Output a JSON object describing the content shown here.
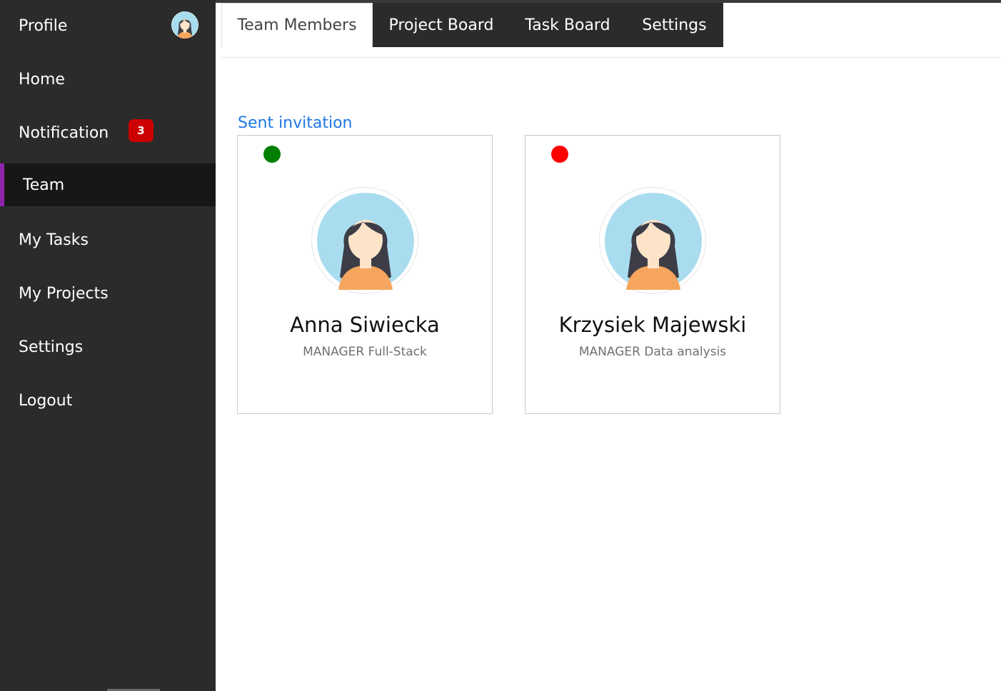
{
  "sidebar": {
    "items": [
      {
        "label": "Profile"
      },
      {
        "label": "Home"
      },
      {
        "label": "Notification",
        "badge": "3"
      },
      {
        "label": "Team",
        "active": true
      },
      {
        "label": "My Tasks"
      },
      {
        "label": "My Projects"
      },
      {
        "label": "Settings"
      },
      {
        "label": "Logout"
      }
    ],
    "accent_color": "#8e24aa",
    "badge_color": "#cc0000"
  },
  "tabs": [
    {
      "label": "Team Members",
      "active": true
    },
    {
      "label": "Project Board"
    },
    {
      "label": "Task Board"
    },
    {
      "label": "Settings"
    }
  ],
  "main": {
    "link_label": "Sent invitation",
    "members": [
      {
        "name": "Anna Siwiecka",
        "role": "MANAGER",
        "specialty": "Full-Stack",
        "status_color": "#008000",
        "avatar_icon": "female-avatar-icon"
      },
      {
        "name": "Krzysiek Majewski",
        "role": "MANAGER",
        "specialty": "Data analysis",
        "status_color": "#ff0000",
        "avatar_icon": "female-avatar-icon"
      }
    ]
  }
}
